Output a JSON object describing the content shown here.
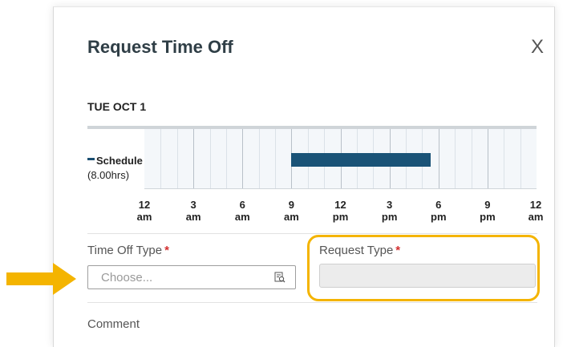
{
  "dialog": {
    "title": "Request Time Off",
    "close_symbol": "X"
  },
  "schedule": {
    "date": "TUE OCT 1",
    "legend_label": "Schedule",
    "hours": "(8.00hrs)",
    "shift_start_hour": 9,
    "shift_end_hour": 17.5,
    "axis_ticks": [
      {
        "hour": "12",
        "period": "am"
      },
      {
        "hour": "3",
        "period": "am"
      },
      {
        "hour": "6",
        "period": "am"
      },
      {
        "hour": "9",
        "period": "am"
      },
      {
        "hour": "12",
        "period": "pm"
      },
      {
        "hour": "3",
        "period": "pm"
      },
      {
        "hour": "6",
        "period": "pm"
      },
      {
        "hour": "9",
        "period": "pm"
      },
      {
        "hour": "12",
        "period": "am"
      }
    ]
  },
  "form": {
    "time_off_type_label": "Time Off Type",
    "time_off_type_placeholder": "Choose...",
    "request_type_label": "Request Type",
    "required_marker": "*",
    "comment_label": "Comment"
  },
  "colors": {
    "shift_bar": "#1a5377",
    "highlight_box": "#f4b400",
    "arrow": "#f4b400",
    "required": "#d32f2f"
  },
  "icons": {
    "lookup": "lookup-icon",
    "close": "close-icon",
    "arrow": "arrow-right-icon"
  }
}
